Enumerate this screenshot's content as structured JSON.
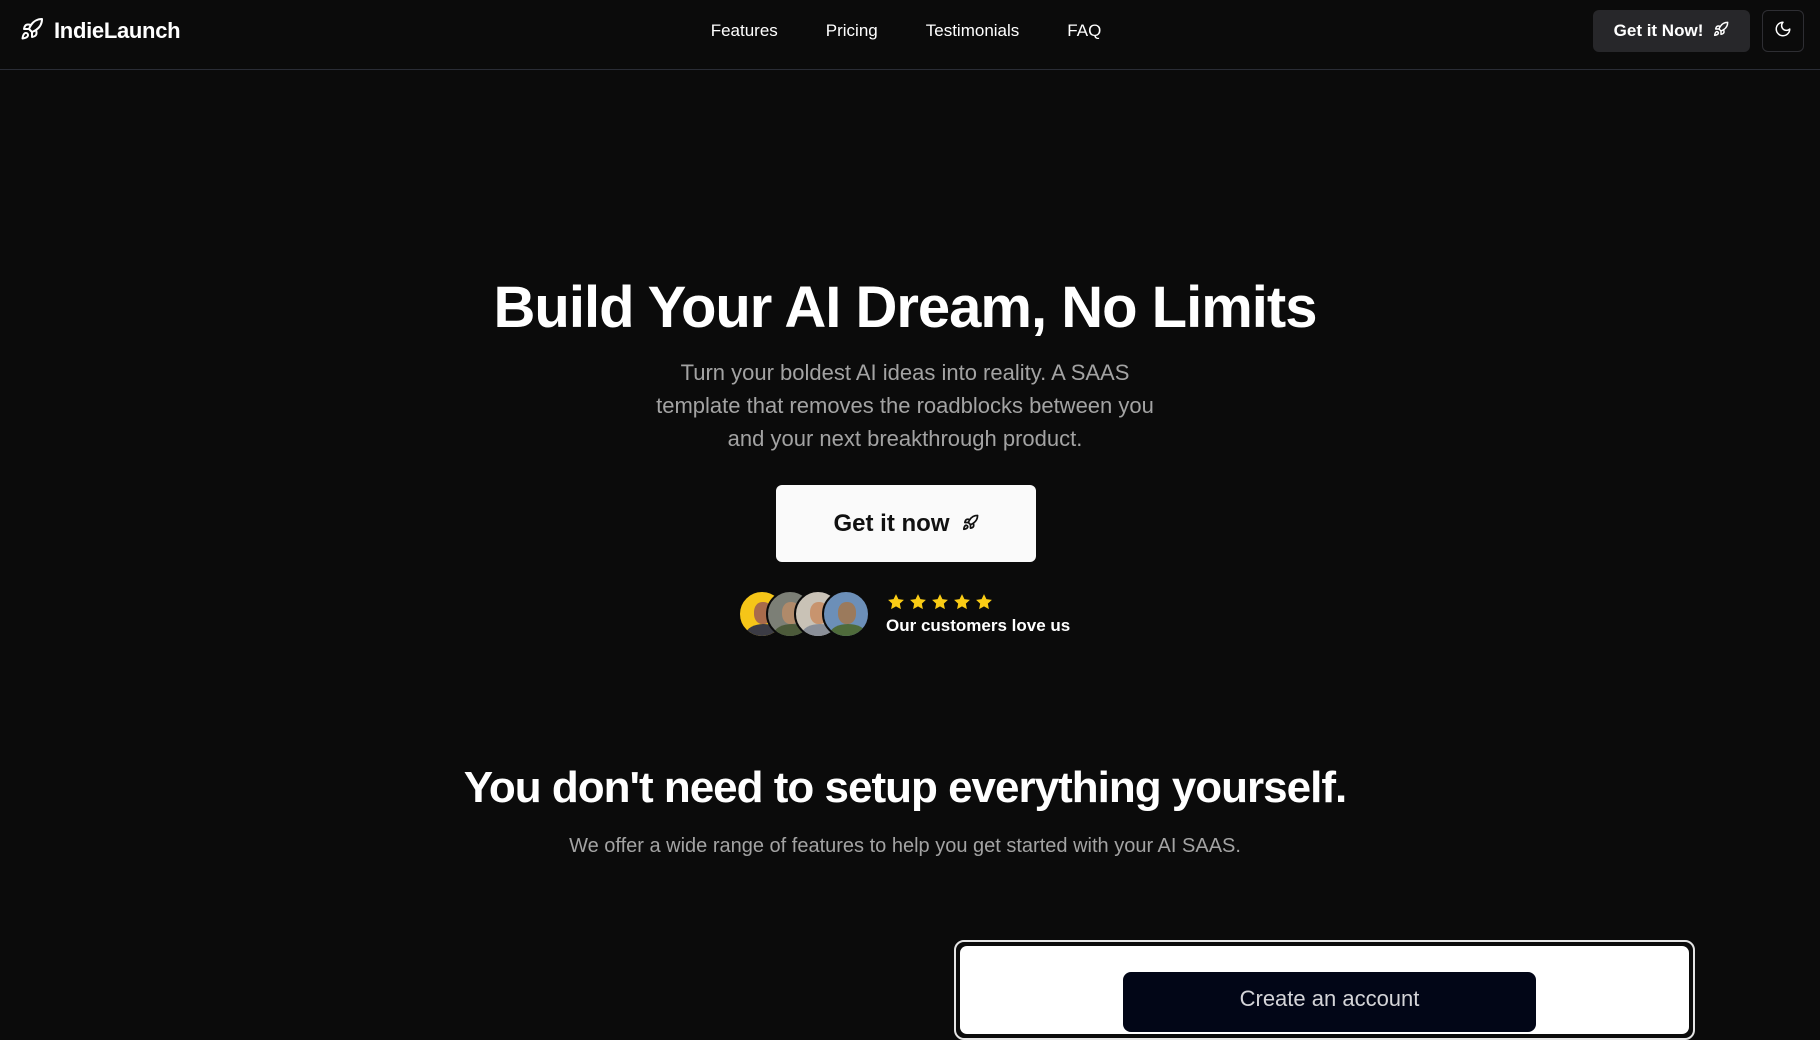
{
  "header": {
    "brand_name": "IndieLaunch",
    "brand_icon": "rocket-icon",
    "nav": [
      {
        "label": "Features"
      },
      {
        "label": "Pricing"
      },
      {
        "label": "Testimonials"
      },
      {
        "label": "FAQ"
      }
    ],
    "cta_label": "Get it Now!",
    "theme_icon": "moon-icon"
  },
  "hero": {
    "title": "Build Your AI Dream, No Limits",
    "subtitle": "Turn your boldest AI ideas into reality. A SAAS template that removes the roadblocks between you and your next breakthrough product.",
    "cta_label": "Get it now",
    "rating_stars": 5,
    "rating_text": "Our customers love us"
  },
  "features": {
    "title": "You don't need to setup everything yourself.",
    "subtitle": "We offer a wide range of features to help you get started with your AI SAAS.",
    "preview_button_label": "Create an account"
  },
  "colors": {
    "background": "#0b0b0b",
    "star": "#facc15",
    "muted_text": "#a3a3a3",
    "nav_cta_bg": "#27272a"
  }
}
